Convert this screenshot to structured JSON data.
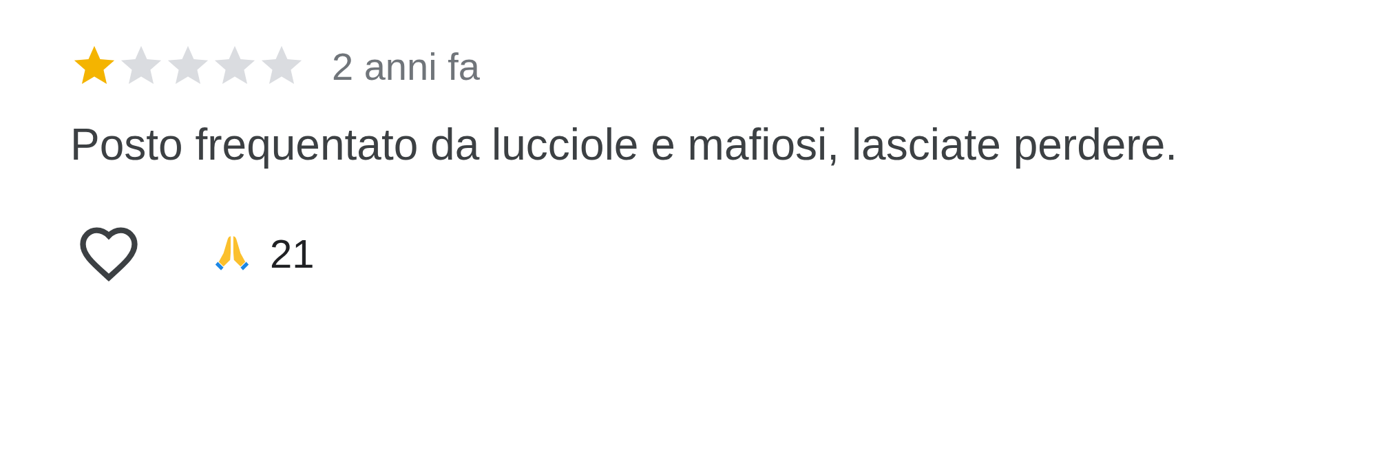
{
  "review": {
    "stars": 1,
    "time": "2 anni fa",
    "text": "Posto frequentato da lucciole e mafiosi, lasciate perdere.",
    "reaction_count": "21"
  }
}
